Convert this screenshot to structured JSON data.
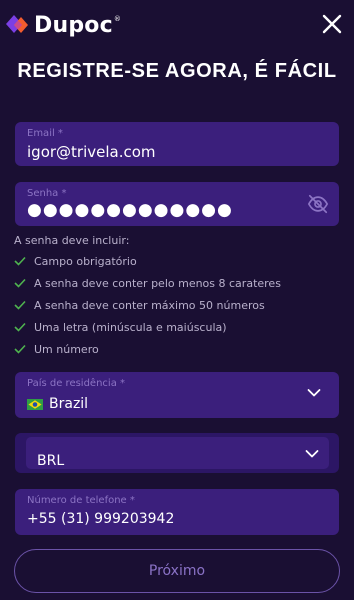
{
  "brand": {
    "name": "Dupoc",
    "reg": "®"
  },
  "header": {
    "close_icon": "close-icon"
  },
  "title": "REGISTRE-SE AGORA, É FÁCIL",
  "form": {
    "email": {
      "label": "Email *",
      "value": "igor@trivela.com"
    },
    "password": {
      "label": "Senha *",
      "value": "●●●●●●●●●●●●●",
      "toggle_icon": "eye-off-icon"
    },
    "rules_title": "A senha deve incluir:",
    "rules": [
      "Campo obrigatório",
      "A senha deve conter pelo menos 8 carateres",
      "A senha deve conter máximo 50 números",
      "Uma letra (minúscula e maiúscula)",
      "Um número"
    ],
    "country": {
      "label": "País de residência *",
      "value": "Brazil",
      "flag_icon": "brazil-flag-icon"
    },
    "currency": {
      "value": "BRL"
    },
    "phone": {
      "label": "Número de telefone *",
      "value": "+55 (31) 999203942"
    },
    "next_label": "Próximo"
  },
  "colors": {
    "background": "#1a0f33",
    "field": "#3b1f7c",
    "field_label": "#8c74c4",
    "check": "#4fb34f",
    "button_border": "#6b53a8",
    "logo_purple": "#7b3fe4",
    "logo_orange": "#f25c2e"
  }
}
